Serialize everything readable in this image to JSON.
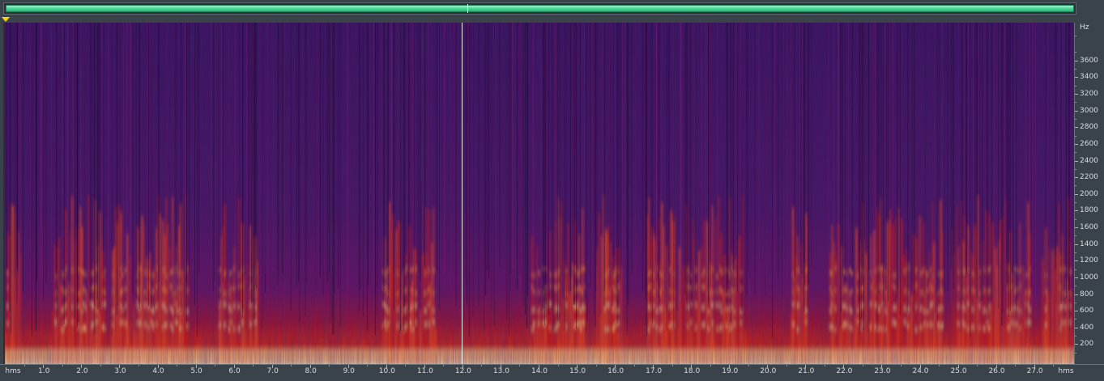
{
  "overview": {
    "fill_color": "#4fd89b"
  },
  "spectrogram": {
    "colormap": [
      "#1d0a3c",
      "#4a0f6a",
      "#8c1257",
      "#d01b1b",
      "#ff5a00",
      "#ffb347",
      "#fff7c8"
    ],
    "playhead_time_s": 12.0
  },
  "freq_axis": {
    "unit": "Hz",
    "labels": [
      "3600",
      "3400",
      "3200",
      "3000",
      "2800",
      "2600",
      "2400",
      "2200",
      "2000",
      "1800",
      "1600",
      "1400",
      "1200",
      "1000",
      "800",
      "600",
      "400",
      "200"
    ]
  },
  "time_axis": {
    "start_label": "hms",
    "end_label": "hms",
    "labels": [
      "1.0",
      "2.0",
      "3.0",
      "4.0",
      "5.0",
      "6.0",
      "7.0",
      "8.0",
      "9.0",
      "10.0",
      "11.0",
      "12.0",
      "13.0",
      "14.0",
      "15.0",
      "16.0",
      "17.0",
      "18.0",
      "19.0",
      "20.0",
      "21.0",
      "22.0",
      "23.0",
      "24.0",
      "25.0",
      "26.0",
      "27.0"
    ]
  }
}
